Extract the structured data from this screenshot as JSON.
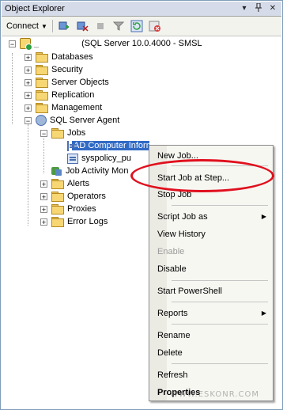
{
  "window": {
    "title": "Object Explorer"
  },
  "toolbar": {
    "connect_label": "Connect",
    "buttons": [
      "connect-db-icon",
      "connect-object-icon",
      "stop-icon",
      "filter-icon",
      "refresh-icon",
      "disconnect-icon"
    ]
  },
  "tree": {
    "server": "(SQL Server 10.0.4000 - SMSL",
    "items": [
      {
        "label": "Databases"
      },
      {
        "label": "Security"
      },
      {
        "label": "Server Objects"
      },
      {
        "label": "Replication"
      },
      {
        "label": "Management"
      },
      {
        "label": "SQL Server Agent"
      }
    ],
    "agent": {
      "jobs_label": "Jobs",
      "jobs": [
        "AD Computer Information",
        "syspolicy_pu"
      ],
      "activity_monitor": "Job Activity Mon",
      "children": [
        "Alerts",
        "Operators",
        "Proxies",
        "Error Logs"
      ]
    }
  },
  "menu": {
    "items": {
      "new_job": "New Job...",
      "start_job_at_step": "Start Job at Step...",
      "stop_job": "Stop Job",
      "script_job_as": "Script Job as",
      "view_history": "View History",
      "enable": "Enable",
      "disable": "Disable",
      "start_powershell": "Start PowerShell",
      "reports": "Reports",
      "rename": "Rename",
      "delete": "Delete",
      "refresh": "Refresh",
      "properties": "Properties"
    }
  },
  "watermark": "WWW.ESKONR.COM",
  "colors": {
    "selection": "#316ac5",
    "annotation": "#e0101e"
  }
}
